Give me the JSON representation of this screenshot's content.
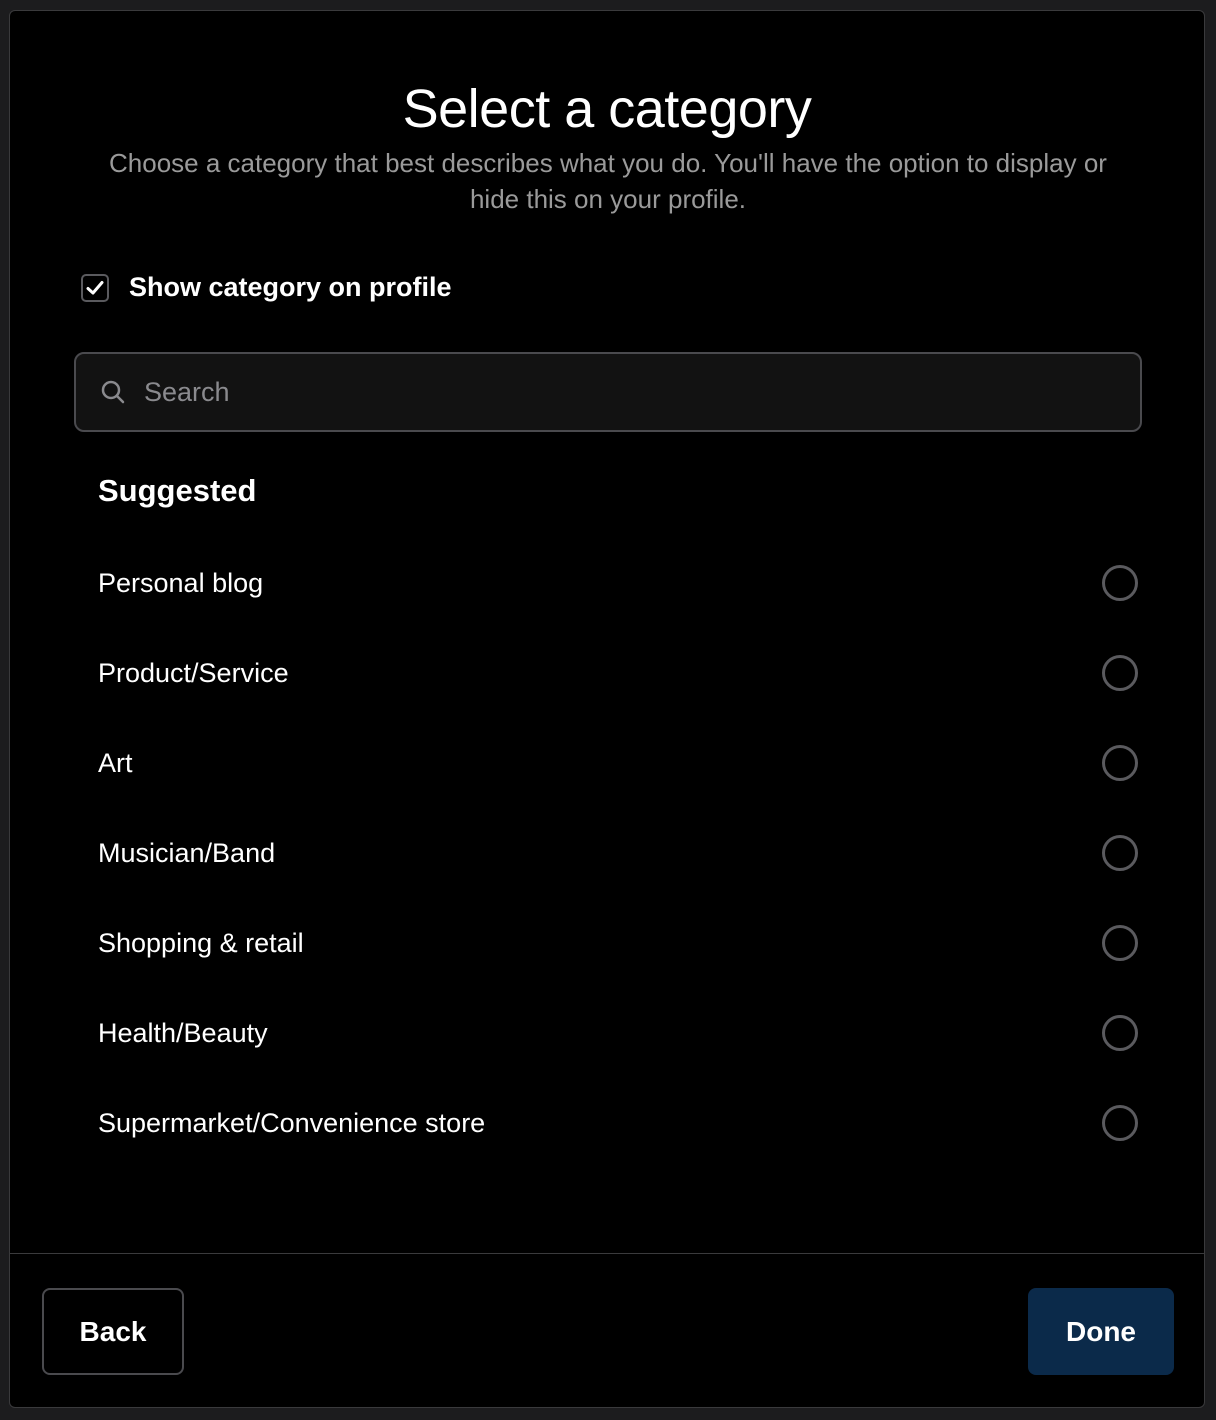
{
  "dialog": {
    "title": "Select a category",
    "subtitle": "Choose a category that best describes what you do. You'll have the option to display or hide this on your profile."
  },
  "show_category": {
    "label": "Show category on profile",
    "checked": true
  },
  "search": {
    "placeholder": "Search",
    "value": "",
    "icon": "search-icon"
  },
  "suggested": {
    "heading": "Suggested",
    "items": [
      {
        "label": "Personal blog",
        "selected": false
      },
      {
        "label": "Product/Service",
        "selected": false
      },
      {
        "label": "Art",
        "selected": false
      },
      {
        "label": "Musician/Band",
        "selected": false
      },
      {
        "label": "Shopping & retail",
        "selected": false
      },
      {
        "label": "Health/Beauty",
        "selected": false
      },
      {
        "label": "Supermarket/Convenience store",
        "selected": false
      }
    ]
  },
  "footer": {
    "back_label": "Back",
    "done_label": "Done"
  },
  "colors": {
    "background": "#000000",
    "done_button": "#0b2a4a",
    "border": "#4a4a4e",
    "muted_text": "#9a9a9a"
  }
}
